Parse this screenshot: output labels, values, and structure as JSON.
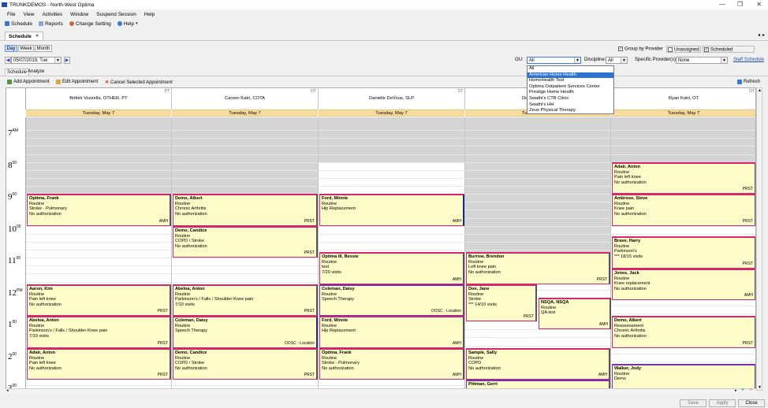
{
  "window": {
    "title": "TRUNKDEMOS - North-West Optima",
    "min": "—",
    "restore": "❐",
    "close": "✕"
  },
  "menu": [
    "File",
    "View",
    "Activities",
    "Window",
    "Suspend Session",
    "Help"
  ],
  "toolbar": {
    "schedule": "Schedule",
    "reports": "Reports",
    "change_setting": "Change Setting",
    "help": "Help"
  },
  "doc_tab": {
    "label": "Schedule",
    "close": "✕"
  },
  "view_buttons": [
    "Day",
    "Week",
    "Month"
  ],
  "date_nav": {
    "date": "05/07/2019, Tue"
  },
  "options": {
    "group_by_provider": "Group by Provider",
    "unassigned": "Unassigned",
    "scheduled": "Scheduled"
  },
  "filters": {
    "ou_label": "OU:",
    "ou_value": "All",
    "discipline_label": "Discipline:",
    "discipline_value": "All",
    "provider_label": "Specific Provider(s):",
    "provider_value": "None",
    "staff_schedule": "Staff Schedule"
  },
  "ou_options": [
    "All",
    "American Home Health",
    "HomeHealth Test",
    "Optima Outpatient Services Center",
    "Prestige Home Health",
    "Swathi's CTB Clinic",
    "Swathi's HH",
    "Zeus Physical Therapy"
  ],
  "ou_highlight_index": 1,
  "subtabs": [
    "Schedule",
    "Analyze"
  ],
  "actions": {
    "add": "Add Appointment",
    "edit": "Edit Appointment",
    "cancel": "Cancel Selected Appointment",
    "refresh": "Refresh"
  },
  "providers": [
    {
      "name": "Brittini Vozzella, OTHER, PT",
      "type": "PT",
      "date": "Tuesday, May 7"
    },
    {
      "name": "Carson Katri, COTA",
      "type": "OT",
      "date": "Tuesday, May 7"
    },
    {
      "name": "Danielle DeVous, SLP",
      "type": "ST",
      "date": "Tuesday, May 7"
    },
    {
      "name": "Do",
      "type": "",
      "date": "Tu"
    },
    {
      "name": "Ryan Katri, OT",
      "type": "OT",
      "date": "Tuesday, May 7"
    }
  ],
  "hours": [
    {
      "h": "7",
      "s": "AM"
    },
    {
      "h": "8",
      "s": "00"
    },
    {
      "h": "9",
      "s": "00"
    },
    {
      "h": "10",
      "s": "00"
    },
    {
      "h": "11",
      "s": "00"
    },
    {
      "h": "12",
      "s": "PM"
    },
    {
      "h": "1",
      "s": "00"
    },
    {
      "h": "2",
      "s": "00"
    },
    {
      "h": "3",
      "s": "00"
    }
  ],
  "appointments": [
    {
      "col": 0,
      "start": 9.0,
      "end": 10.0,
      "name": "Optima, Frank",
      "lines": [
        "Routine",
        "Stroke - Pulmonary",
        "No authorization"
      ],
      "code": "AMH",
      "style": ""
    },
    {
      "col": 0,
      "start": 11.83,
      "end": 12.83,
      "name": "Aaron, Kim",
      "lines": [
        "Routine",
        "Pain left knee",
        "No authorization"
      ],
      "code": "PRST",
      "style": ""
    },
    {
      "col": 0,
      "start": 12.83,
      "end": 13.83,
      "name": "Abeloa, Anton",
      "lines": [
        "Routine",
        "Parkinson's / Falls / Shoulder-Knee pain",
        "7/10 visits"
      ],
      "code": "PRST",
      "style": ""
    },
    {
      "col": 0,
      "start": 13.83,
      "end": 14.83,
      "name": "Adair, Anton",
      "lines": [
        "Routine",
        "Pain left knee",
        "No authorization"
      ],
      "code": "PRST",
      "style": ""
    },
    {
      "col": 1,
      "start": 9.0,
      "end": 10.0,
      "name": "Demo, Albert",
      "lines": [
        "Routine",
        "Chronic Arthritis",
        "No authorization"
      ],
      "code": "PRST",
      "style": ""
    },
    {
      "col": 1,
      "start": 10.0,
      "end": 11.0,
      "name": "Demo, Candice",
      "lines": [
        "Routine",
        "COPD / Stroke",
        "No authorization"
      ],
      "code": "PRST",
      "style": ""
    },
    {
      "col": 1,
      "start": 11.83,
      "end": 12.83,
      "name": "Abeloa, Anton",
      "lines": [
        "Routine",
        "Parkinson's / Falls / Shoulder-Knee pain",
        "7/10 visits"
      ],
      "code": "PRST",
      "style": ""
    },
    {
      "col": 1,
      "start": 12.83,
      "end": 13.83,
      "name": "Coleman, Daisy",
      "lines": [
        "Routine",
        "Speech Therapy"
      ],
      "code": "OOSC - Location",
      "style": "blue"
    },
    {
      "col": 1,
      "start": 13.83,
      "end": 14.83,
      "name": "Demo, Candice",
      "lines": [
        "Routine",
        "COPD / Stroke",
        "No authorization"
      ],
      "code": "PRST",
      "style": ""
    },
    {
      "col": 2,
      "start": 9.0,
      "end": 10.0,
      "name": "Ford, Minnie",
      "lines": [
        "Routine",
        "Hip Replacement"
      ],
      "code": "AMH",
      "style": "blue"
    },
    {
      "col": 2,
      "start": 10.83,
      "end": 11.83,
      "name": "Optima III, Bessie",
      "lines": [
        "Routine",
        "test",
        "7/20 visits"
      ],
      "code": "AMH",
      "style": ""
    },
    {
      "col": 2,
      "start": 11.83,
      "end": 12.83,
      "name": "Coleman, Daisy",
      "lines": [
        "Routine",
        "Speech Therapy"
      ],
      "code": "OOSC - Location",
      "style": "purple"
    },
    {
      "col": 2,
      "start": 12.83,
      "end": 13.83,
      "name": "Ford, Minnie",
      "lines": [
        "Routine",
        "Hip Replacement"
      ],
      "code": "AMH",
      "style": ""
    },
    {
      "col": 2,
      "start": 13.83,
      "end": 14.83,
      "name": "Optima, Frank",
      "lines": [
        "Routine",
        "Stroke - Pulmonary",
        "No authorization"
      ],
      "code": "AMH",
      "style": ""
    },
    {
      "col": 3,
      "start": 10.83,
      "end": 11.83,
      "name": "Burrow, Brendon",
      "lines": [
        "Routine",
        "Left knee pain",
        "No authorization"
      ],
      "code": "PRST",
      "style": ""
    },
    {
      "col": 3,
      "start": 11.83,
      "end": 13.0,
      "name": "Doe, Jane",
      "lines": [
        "Routine",
        "Stroke",
        "*** 14/10 visits"
      ],
      "code": "PRST",
      "style": "",
      "half": "left"
    },
    {
      "col": 3,
      "start": 12.25,
      "end": 13.25,
      "name": "NSQA, NSQA",
      "lines": [
        "Routine",
        "QA test"
      ],
      "code": "AMH",
      "style": "",
      "half": "right"
    },
    {
      "col": 3,
      "start": 13.83,
      "end": 14.83,
      "name": "Sample, Sally",
      "lines": [
        "Routine",
        "COPD",
        "No authorization"
      ],
      "code": "AMH",
      "style": ""
    },
    {
      "col": 3,
      "start": 14.83,
      "end": 15.2,
      "name": "Pittman, Gerri",
      "lines": [],
      "code": "",
      "style": "purple"
    },
    {
      "col": 4,
      "start": 8.0,
      "end": 9.0,
      "name": "Adair, Anton",
      "lines": [
        "Routine",
        "Pain left knee",
        "No authorization"
      ],
      "code": "PRST",
      "style": ""
    },
    {
      "col": 4,
      "start": 9.0,
      "end": 10.0,
      "name": "Ambrose, Steve",
      "lines": [
        "Routine",
        "Knee pain",
        "No authorization"
      ],
      "code": "PRST",
      "style": ""
    },
    {
      "col": 4,
      "start": 10.33,
      "end": 11.33,
      "name": "Brave, Harry",
      "lines": [
        "Routine",
        "Parkinson's",
        "*** 18/15 visits"
      ],
      "code": "PRST",
      "style": ""
    },
    {
      "col": 4,
      "start": 11.33,
      "end": 12.33,
      "name": "Jones, Jack",
      "lines": [
        "Routine",
        "Knee replacement",
        "No authorization"
      ],
      "code": "AMH",
      "style": ""
    },
    {
      "col": 4,
      "start": 12.83,
      "end": 13.83,
      "name": "Demo, Albert",
      "lines": [
        "Reassessment",
        "Chronic Arthritis",
        "No authorization"
      ],
      "code": "PRST",
      "style": ""
    },
    {
      "col": 4,
      "start": 14.33,
      "end": 15.33,
      "name": "Walker, Jody",
      "lines": [
        "Routine",
        "Demo"
      ],
      "code": "OOSC - Location",
      "style": "purple"
    }
  ],
  "footer": {
    "save": "Save",
    "apply": "Apply",
    "close": "Close"
  },
  "colors": {
    "accent": "#d5266f",
    "date_band": "#f7dca0",
    "appt_bg": "#fdfcc8",
    "unavailable": "#d4d4d4",
    "highlight": "#2f73d1"
  }
}
